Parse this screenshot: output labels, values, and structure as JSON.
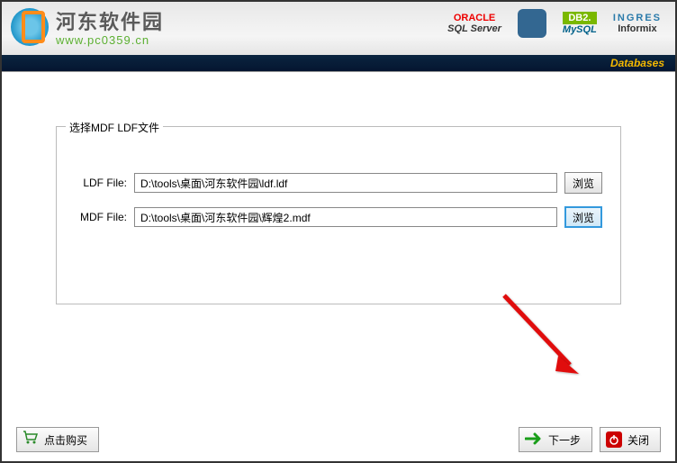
{
  "header": {
    "logo_title": "河东软件园",
    "logo_url": "www.pc0359.cn",
    "brands": {
      "oracle": "ORACLE",
      "sqlserver": "SQL Server",
      "db2": "DB2.",
      "mysql": "MySQL",
      "ingres": "INGRES",
      "informix": "Informix"
    },
    "databases_label": "Databases"
  },
  "form": {
    "legend": "选择MDF LDF文件",
    "ldf_label": "LDF File:",
    "ldf_value": "D:\\tools\\桌面\\河东软件园\\ldf.ldf",
    "mdf_label": "MDF File:",
    "mdf_value": "D:\\tools\\桌面\\河东软件园\\辉煌2.mdf",
    "browse_label": "浏览"
  },
  "footer": {
    "buy_label": "点击购买",
    "next_label": "下一步",
    "close_label": "关闭"
  }
}
